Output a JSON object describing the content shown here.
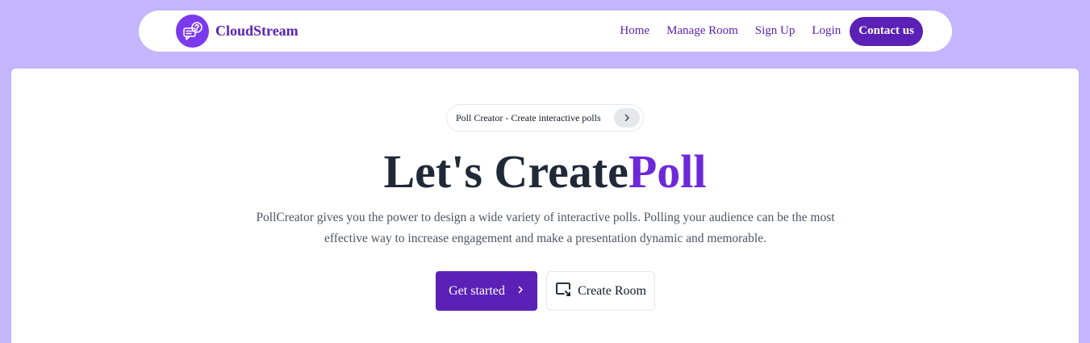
{
  "navbar": {
    "brand": "CloudStream",
    "logo_icon": "chat-question-icon",
    "links": [
      "Home",
      "Manage Room",
      "Sign Up",
      "Login"
    ],
    "contact_label": "Contact us"
  },
  "hero": {
    "pill_text": "Poll Creator - Create interactive polls",
    "title_main": "Let's Create",
    "title_accent": "Poll",
    "description": "PollCreator gives you the power to design a wide variety of interactive polls. Polling your audience can be the most effective way to increase engagement and make a presentation dynamic and memorable.",
    "primary_button": "Get started",
    "secondary_button": "Create Room",
    "secondary_icon": "screen-share-icon"
  },
  "colors": {
    "background": "#c4b5fd",
    "brand": "#5b21b6",
    "accent": "#6d28d9",
    "logo": "#7c3aed"
  }
}
